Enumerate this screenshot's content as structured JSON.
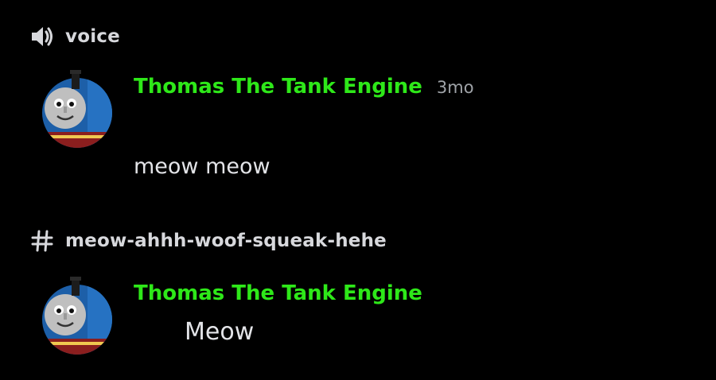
{
  "voice_channel": {
    "icon": "speaker-icon",
    "name": "voice"
  },
  "messages_voice": [
    {
      "author": "Thomas The Tank Engine",
      "author_color": "#2ee819",
      "timestamp": "3mo",
      "text": "meow meow",
      "avatar": "thomas-engine-avatar"
    }
  ],
  "text_channel": {
    "icon": "hash-icon",
    "name": "meow-ahhh-woof-squeak-hehe"
  },
  "messages_text": [
    {
      "author": "Thomas The Tank Engine",
      "author_color": "#2ee819",
      "text": "Meow",
      "avatar": "thomas-engine-avatar"
    }
  ]
}
